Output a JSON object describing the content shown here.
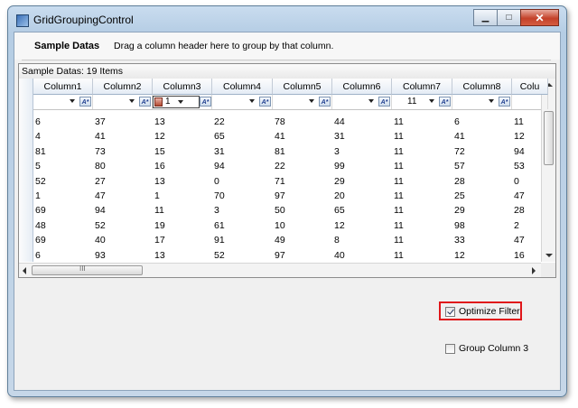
{
  "window": {
    "title": "GridGroupingControl",
    "minimize": "▁",
    "maximize": "□",
    "close": "✕"
  },
  "header": {
    "title": "Sample Datas",
    "hint": "Drag a column header here to group by that column."
  },
  "grid": {
    "caption": "Sample Datas: 19 Items",
    "columns": [
      "Column1",
      "Column2",
      "Column3",
      "Column4",
      "Column5",
      "Column6",
      "Column7",
      "Column8",
      "Colu"
    ],
    "filter_values": [
      "",
      "",
      "1",
      "",
      "",
      "",
      "11",
      "",
      ""
    ],
    "rows": [
      [
        "6",
        "37",
        "13",
        "22",
        "78",
        "44",
        "11",
        "6",
        "11"
      ],
      [
        "4",
        "41",
        "12",
        "65",
        "41",
        "31",
        "11",
        "41",
        "12"
      ],
      [
        "81",
        "73",
        "15",
        "31",
        "81",
        "3",
        "11",
        "72",
        "94"
      ],
      [
        "5",
        "80",
        "16",
        "94",
        "22",
        "99",
        "11",
        "57",
        "53"
      ],
      [
        "52",
        "27",
        "13",
        "0",
        "71",
        "29",
        "11",
        "28",
        "0"
      ],
      [
        "1",
        "47",
        "1",
        "70",
        "97",
        "20",
        "11",
        "25",
        "47"
      ],
      [
        "69",
        "94",
        "11",
        "3",
        "50",
        "65",
        "11",
        "29",
        "28"
      ],
      [
        "48",
        "52",
        "19",
        "61",
        "10",
        "12",
        "11",
        "98",
        "2"
      ],
      [
        "69",
        "40",
        "17",
        "91",
        "49",
        "8",
        "11",
        "33",
        "47"
      ],
      [
        "6",
        "93",
        "13",
        "52",
        "97",
        "40",
        "11",
        "12",
        "16"
      ]
    ],
    "hscroll_grip": "III"
  },
  "options": {
    "optimize_filter": "Optimize Filter",
    "group_column_3": "Group Column 3"
  }
}
